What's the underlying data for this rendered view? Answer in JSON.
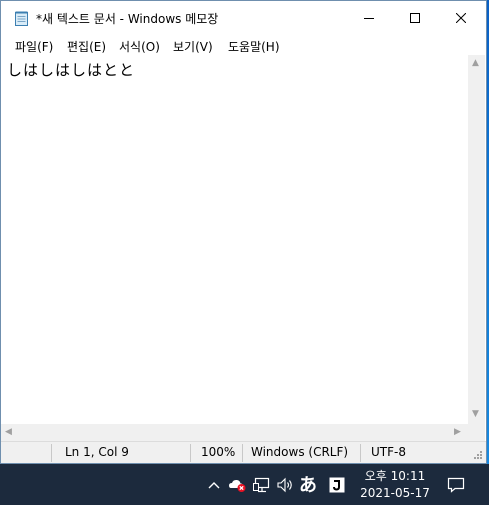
{
  "window": {
    "title": "*새 텍스트 문서 - Windows 메모장"
  },
  "menu": [
    {
      "label": "파일(F)"
    },
    {
      "label": "편집(E)"
    },
    {
      "label": "서식(O)"
    },
    {
      "label": "보기(V)"
    },
    {
      "label": "도움말(H)"
    }
  ],
  "editor": {
    "content": "しはしはしはとと"
  },
  "status": {
    "position": "Ln 1, Col 9",
    "zoom": "100%",
    "line_ending": "Windows (CRLF)",
    "encoding": "UTF-8"
  },
  "taskbar": {
    "ime_label": "あ",
    "time": "오후 10:11",
    "date": "2021-05-17"
  },
  "icons": [
    "notepad-app-icon",
    "minimize-icon",
    "maximize-icon",
    "close-icon",
    "chevron-up-icon",
    "onedrive-error-icon",
    "network-icon",
    "volume-icon",
    "ime-mode-icon",
    "notification-icon"
  ]
}
